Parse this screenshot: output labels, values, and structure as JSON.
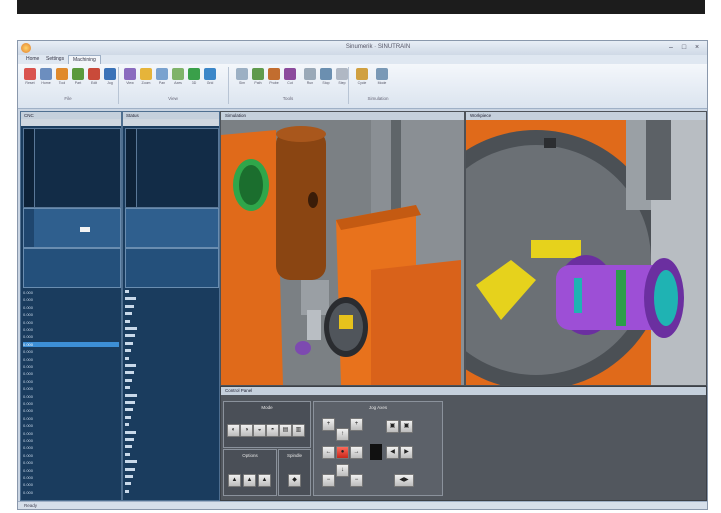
{
  "app": {
    "title": "Sinumerik · SINUTRAIN",
    "window_controls": [
      "–",
      "□",
      "×"
    ],
    "tabs": [
      {
        "label": "Home"
      },
      {
        "label": "Settings"
      },
      {
        "label": "Machining"
      }
    ]
  },
  "ribbon": {
    "buttons": [
      {
        "label": "Reset",
        "color": "#d9534f"
      },
      {
        "label": "Home",
        "color": "#6c8ebf"
      },
      {
        "label": "Tool",
        "color": "#e08a2c"
      },
      {
        "label": "Part",
        "color": "#5b9a3c"
      },
      {
        "label": "Edit",
        "color": "#c94a3a"
      },
      {
        "label": "Jog",
        "color": "#3a72b8"
      },
      {
        "label": "View",
        "color": "#8a6bbf"
      },
      {
        "label": "Zoom",
        "color": "#e6b43a"
      },
      {
        "label": "Pan",
        "color": "#7aa2cf"
      },
      {
        "label": "Axes",
        "color": "#7fb36a"
      },
      {
        "label": "3D",
        "color": "#3aa04a"
      },
      {
        "label": "Grid",
        "color": "#3a86c8"
      },
      {
        "label": "Sim",
        "color": "#9cb0c4"
      },
      {
        "label": "Path",
        "color": "#5f9a4d"
      },
      {
        "label": "Probe",
        "color": "#c26d2f"
      },
      {
        "label": "Cut",
        "color": "#8b4a9c"
      },
      {
        "label": "Run",
        "color": "#9aa9b8"
      },
      {
        "label": "Stop",
        "color": "#6b8fb0"
      },
      {
        "label": "Step",
        "color": "#b0b8c4"
      },
      {
        "label": "Cycle",
        "color": "#d0a040"
      },
      {
        "label": "Mode",
        "color": "#7a99b6"
      }
    ],
    "groups": [
      {
        "label": "File"
      },
      {
        "label": "View"
      },
      {
        "label": "Tools"
      },
      {
        "label": "Simulation"
      }
    ]
  },
  "left_panel": {
    "header": "CNC",
    "rows": [
      "0.000",
      "0.000",
      "0.000",
      "0.000",
      "0.000",
      "0.000",
      "0.000",
      "0.000",
      "0.000",
      "0.000",
      "0.000",
      "0.000",
      "0.000",
      "0.000",
      "0.000",
      "0.000",
      "0.000",
      "0.000",
      "0.000",
      "0.000",
      "0.000",
      "0.000",
      "0.000",
      "0.000",
      "0.000",
      "0.000",
      "0.000",
      "0.000"
    ]
  },
  "mid_panel": {
    "header": "Status"
  },
  "views": {
    "left_header": "Simulation",
    "right_header": "Workpiece"
  },
  "jog": {
    "header": "Control Panel",
    "group_a": "Mode",
    "group_b": "Options",
    "group_c": "Spindle",
    "group_d": "Jog Axes",
    "buttons_a": [
      "◐",
      "◑",
      "◒",
      "◓",
      "▤",
      "▥"
    ],
    "buttons_b": [
      "▲",
      "▲",
      "▲"
    ],
    "buttons_c": [
      "◆"
    ],
    "buttons_d": [
      "+",
      "↑",
      "+",
      "←",
      "●",
      "→",
      "−",
      "↓",
      "−"
    ],
    "side_buttons": [
      "▣",
      "▣",
      "◀",
      "▶",
      "◀▶"
    ]
  },
  "status": {
    "text": "Ready"
  }
}
